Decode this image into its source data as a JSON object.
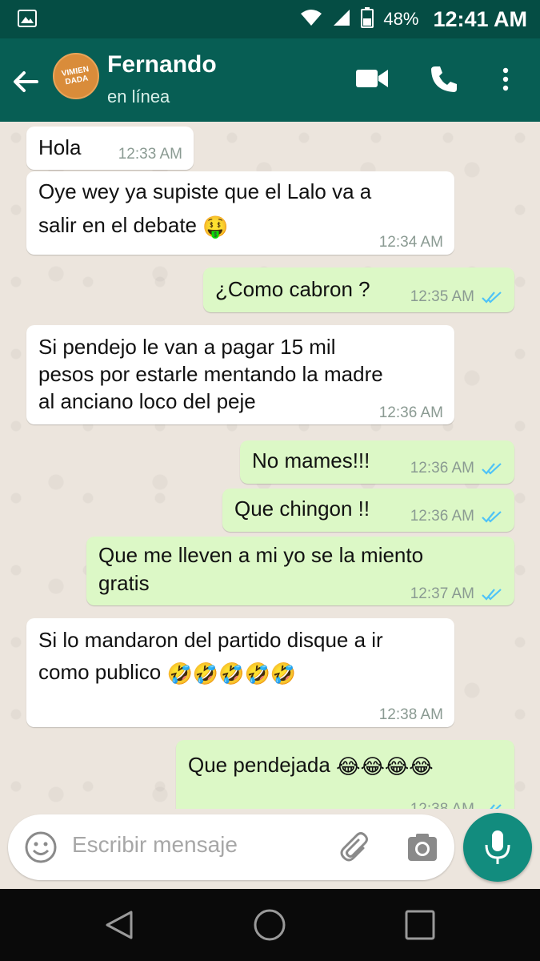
{
  "status_bar": {
    "battery": "48%",
    "time": "12:41 AM"
  },
  "header": {
    "contact_name": "Fernando",
    "contact_status": "en línea",
    "avatar_text": "VIMIEN DADA"
  },
  "messages": [
    {
      "direction": "in",
      "text": "Hola",
      "time": "12:33 AM"
    },
    {
      "direction": "in",
      "text_line1": "Oye wey ya supiste que el Lalo va a",
      "text_line2": "salir en el debate",
      "emoji": "🤑",
      "time": "12:34 AM"
    },
    {
      "direction": "out",
      "text": "¿Como cabron ?",
      "time": "12:35 AM"
    },
    {
      "direction": "in",
      "text_line1": "Si pendejo le van a pagar 15 mil",
      "text_line2": "pesos por estarle mentando la madre",
      "text_line3": "al anciano loco del peje",
      "time": "12:36 AM"
    },
    {
      "direction": "out",
      "text": "No mames!!!",
      "time": "12:36 AM"
    },
    {
      "direction": "out",
      "text": "Que chingon !!",
      "time": "12:36 AM"
    },
    {
      "direction": "out",
      "text_line1": "Que me lleven a mi yo se la miento",
      "text_line2": "gratis",
      "time": "12:37 AM"
    },
    {
      "direction": "in",
      "text_line1": "Si lo mandaron del partido disque a ir",
      "text_line2": "como publico",
      "emoji": "🤣🤣🤣🤣🤣",
      "time": "12:38 AM"
    },
    {
      "direction": "out",
      "text": "Que pendejada",
      "emoji": "😂😂😂😂",
      "time": "12:38 AM"
    }
  ],
  "input": {
    "placeholder": "Escribir mensaje"
  },
  "colors": {
    "header": "#075e54",
    "status_bar": "#054d44",
    "outgoing_bubble": "#dcf8c6",
    "incoming_bubble": "#ffffff",
    "read_tick": "#4fc3f7",
    "mic_button": "#128c7e"
  },
  "icons": {
    "back": "arrow-left-icon",
    "video": "video-camera-icon",
    "call": "phone-icon",
    "menu": "more-vertical-icon",
    "emoji": "smiley-icon",
    "attach": "paperclip-icon",
    "camera": "camera-icon",
    "mic": "microphone-icon"
  }
}
